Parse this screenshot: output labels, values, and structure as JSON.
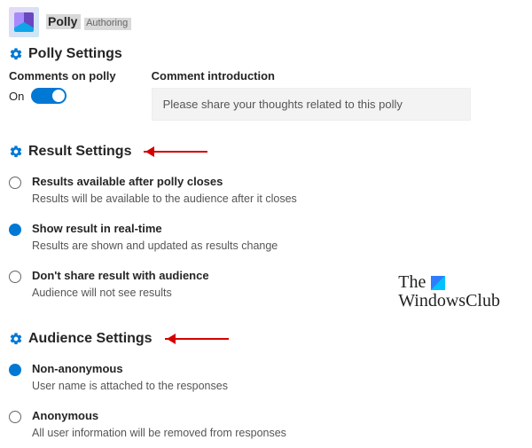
{
  "app": {
    "name": "Polly",
    "subtitle": "Authoring"
  },
  "polly_settings": {
    "heading": "Polly Settings",
    "comments_label": "Comments on polly",
    "comments_state": "On",
    "comment_intro_label": "Comment introduction",
    "comment_intro_value": "Please share your thoughts related to this polly"
  },
  "result_settings": {
    "heading": "Result Settings",
    "options": [
      {
        "title": "Results available after polly closes",
        "desc": "Results will be available to the audience after it closes",
        "checked": false
      },
      {
        "title": "Show result in real-time",
        "desc": "Results are shown and updated as results change",
        "checked": true
      },
      {
        "title": "Don't share result with audience",
        "desc": "Audience will not see results",
        "checked": false
      }
    ]
  },
  "audience_settings": {
    "heading": "Audience Settings",
    "options": [
      {
        "title": "Non-anonymous",
        "desc": "User name is attached to the responses",
        "checked": true
      },
      {
        "title": "Anonymous",
        "desc": "All user information will be removed from responses",
        "checked": false
      }
    ]
  },
  "watermark": {
    "line1": "The",
    "line2": "WindowsClub"
  }
}
